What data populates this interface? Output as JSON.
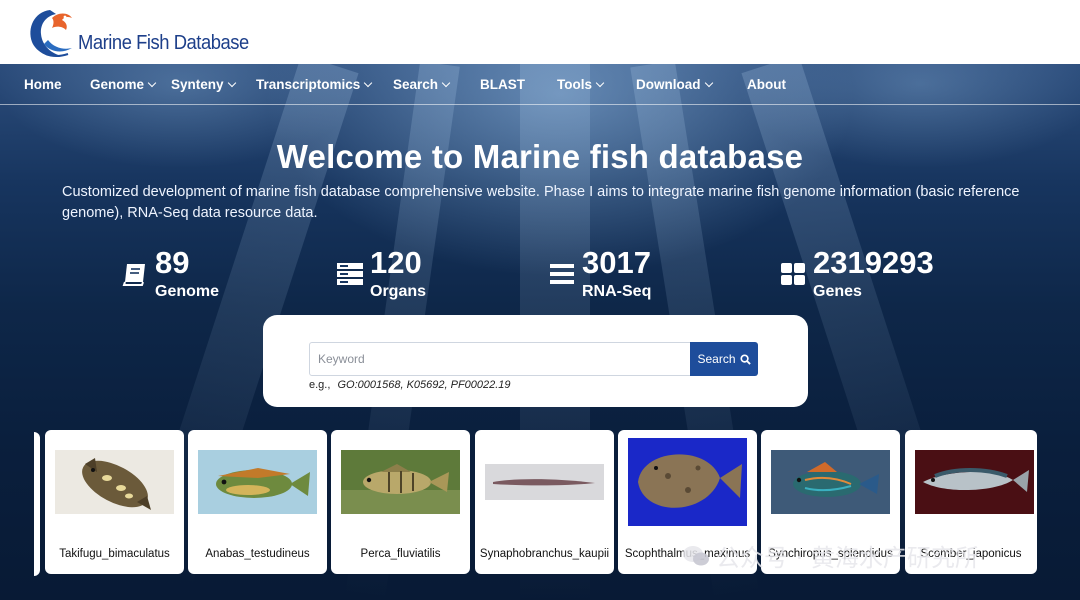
{
  "header": {
    "logo_text": "Marine Fish Database"
  },
  "nav": [
    {
      "label": "Home",
      "dropdown": false
    },
    {
      "label": "Genome",
      "dropdown": true
    },
    {
      "label": "Synteny",
      "dropdown": true
    },
    {
      "label": "Transcriptomics",
      "dropdown": true
    },
    {
      "label": "Search",
      "dropdown": true
    },
    {
      "label": "BLAST",
      "dropdown": false
    },
    {
      "label": "Tools",
      "dropdown": true
    },
    {
      "label": "Download",
      "dropdown": true
    },
    {
      "label": "About",
      "dropdown": false
    }
  ],
  "hero": {
    "title": "Welcome to Marine fish database",
    "description": "Customized development of marine fish database comprehensive website. Phase I aims to integrate marine fish genome information (basic reference genome), RNA-Seq data resource data."
  },
  "stats": [
    {
      "value": "89",
      "label": "Genome",
      "icon": "book-icon"
    },
    {
      "value": "120",
      "label": "Organs",
      "icon": "server-icon"
    },
    {
      "value": "3017",
      "label": "RNA-Seq",
      "icon": "list-icon"
    },
    {
      "value": "2319293",
      "label": "Genes",
      "icon": "grid-icon"
    }
  ],
  "search": {
    "placeholder": "Keyword",
    "button_label": "Search",
    "example_prefix": "e.g.,",
    "examples": "GO:0001568, K05692, PF00022.19"
  },
  "species": [
    {
      "name": "Takifugu_bimaculatus"
    },
    {
      "name": "Anabas_testudineus"
    },
    {
      "name": "Perca_fluviatilis"
    },
    {
      "name": "Synaphobranchus_kaupii"
    },
    {
      "name": "Scophthalmus_maximus"
    },
    {
      "name": "Synchiropus_splendidus"
    },
    {
      "name": "Scomber_japonicus"
    }
  ],
  "watermark": "公众号 · 黄海水产研究所",
  "colors": {
    "brand_blue": "#1e4d9b",
    "logo_orange": "#e8642c",
    "nav_text": "#ffffff"
  }
}
